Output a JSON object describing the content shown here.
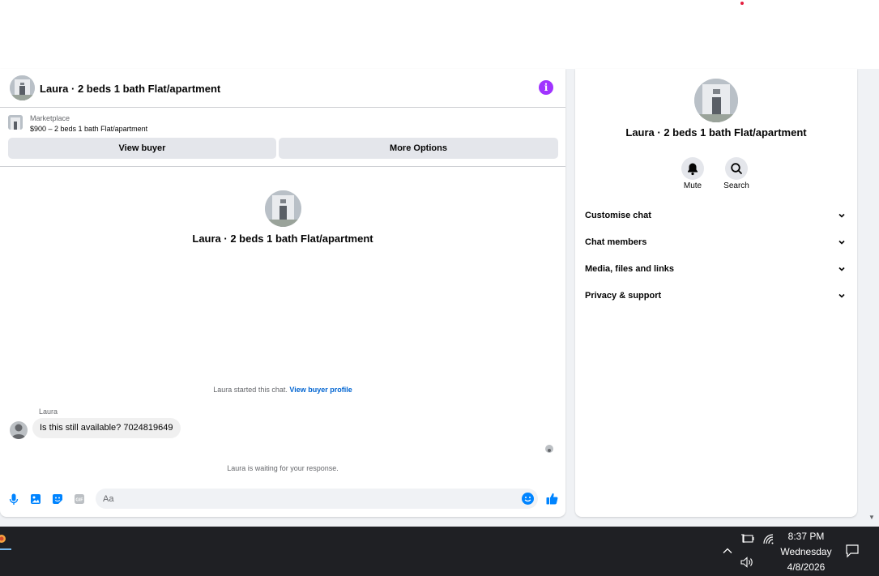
{
  "chat": {
    "title": "Laura · 2 beds 1 bath Flat/apartment",
    "marketplace_label": "Marketplace",
    "listing": "$900 – 2 beds 1 bath Flat/apartment",
    "view_buyer_label": "View buyer",
    "more_options_label": "More Options",
    "center_title": "Laura · 2 beds 1 bath Flat/apartment",
    "started_text": "Laura started this chat.",
    "view_buyer_profile_label": "View buyer profile",
    "sender_name": "Laura",
    "message": "Is this still available? 7024819649",
    "waiting_text": "Laura is waiting for your response.",
    "composer_placeholder": "Aa"
  },
  "sidebar": {
    "title": "Laura · 2 beds 1 bath Flat/apartment",
    "mute_label": "Mute",
    "search_label": "Search",
    "items": [
      {
        "label": "Customise chat"
      },
      {
        "label": "Chat members"
      },
      {
        "label": "Media, files and links"
      },
      {
        "label": "Privacy & support"
      }
    ]
  },
  "taskbar": {
    "time": "8:37 PM",
    "day": "Wednesday",
    "date": "4/8/2026"
  },
  "colors": {
    "accent_blue": "#0084ff",
    "info_purple": "#a033ff",
    "link_blue": "#0064d1"
  }
}
